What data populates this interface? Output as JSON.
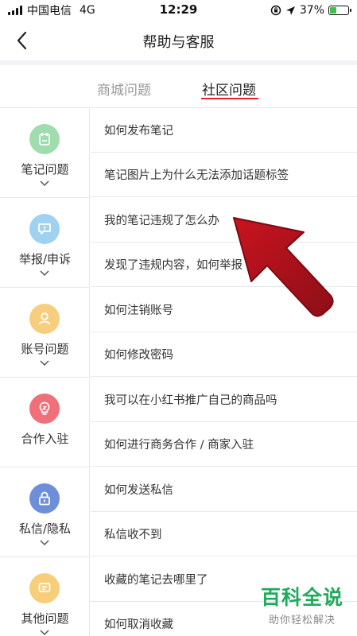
{
  "status_bar": {
    "carrier": "中国电信",
    "network": "4G",
    "time": "12:29",
    "battery_percent": "37%",
    "battery_level": 0.37
  },
  "header": {
    "title": "帮助与客服"
  },
  "tabs": [
    {
      "label": "商城问题",
      "active": false
    },
    {
      "label": "社区问题",
      "active": true
    }
  ],
  "categories": [
    {
      "label": "笔记问题",
      "icon": "calendar-note-icon",
      "color": "#9fdcae"
    },
    {
      "label": "举报/申诉",
      "icon": "chat-bubble-icon",
      "color": "#9fd1f1"
    },
    {
      "label": "账号问题",
      "icon": "person-icon",
      "color": "#f7ce7e"
    },
    {
      "label": "合作入驻",
      "icon": "lightbulb-icon",
      "color": "#f0707a"
    },
    {
      "label": "私信/隐私",
      "icon": "lock-icon",
      "color": "#6d8ed8"
    },
    {
      "label": "其他问题",
      "icon": "message-icon",
      "color": "#f7cf7a"
    }
  ],
  "questions": [
    "如何发布笔记",
    "笔记图片上为什么无法添加话题标签",
    "我的笔记违规了怎么办",
    "发现了违规内容，如何举报",
    "如何注销账号",
    "如何修改密码",
    "我可以在小红书推广自己的商品吗",
    "如何进行商务合作 / 商家入驻",
    "如何发送私信",
    "私信收不到",
    "收藏的笔记去哪里了",
    "如何取消收藏"
  ],
  "watermark": {
    "title": "百科全说",
    "subtitle": "助你轻松解决"
  },
  "colors": {
    "accent": "#e0243a",
    "arrow": "#b3121f",
    "watermark": "#1faa5c"
  }
}
